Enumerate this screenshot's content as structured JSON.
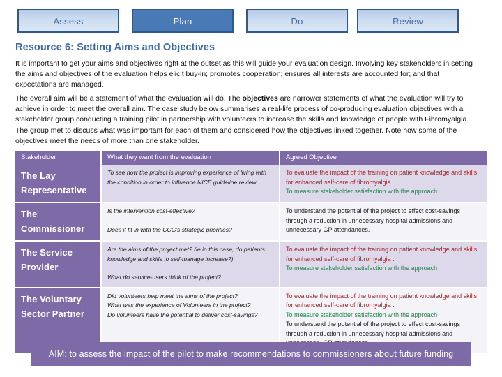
{
  "tabs": [
    {
      "label": "Assess",
      "state": "inactive"
    },
    {
      "label": "Plan",
      "state": "active"
    },
    {
      "label": "Do",
      "state": "inactive"
    },
    {
      "label": "Review",
      "state": "inactive"
    }
  ],
  "resource": {
    "title": "Resource 6: Setting Aims and Objectives",
    "paragraph_1": "It is important to get your aims and objectives right at the outset as this will guide your evaluation design. Involving key stakeholders in setting the aims and objectives of the evaluation helps elicit buy-in; promotes cooperation; ensures all interests are accounted for; and that expectations are managed.",
    "paragraph_2_part_1": "The overall aim will be a statement of what the evaluation will do. The ",
    "paragraph_2_bold": "objectives",
    "paragraph_2_part_2": " are narrower statements of what the evaluation will try to achieve in order to meet the overall aim.  The case study below summarises a real-life process of co-producing evaluation objectives with a stakeholder group conducting a training pilot in partnership with volunteers to increase the skills and knowledge of people with Fibromyalgia.  The group met to discuss what was important for each of them and considered how the objectives linked together. Note how some of the objectives meet the needs of more than one stakeholder."
  },
  "table": {
    "headers": [
      "Stakeholder",
      "What they want from the evaluation",
      "Agreed Objective"
    ],
    "rows": [
      {
        "stakeholder": "The Lay Representative",
        "want": [
          "To see how the project is improving experience of living with the condition in order to influence NICE guideline review"
        ],
        "objectives": [
          {
            "text": "To evaluate the  impact of the training on patient knowledge and skills for enhanced self-care of fibromyalgia",
            "color_name": "red"
          },
          {
            "text": "To measure stakeholder satisfaction with the approach",
            "color_name": "green"
          }
        ]
      },
      {
        "stakeholder": "The Commissioner",
        "want": [
          "Is the intervention cost-effective?",
          "",
          "Does it fit in with the CCG's strategic priorities?"
        ],
        "objectives": [
          {
            "text": "To understand the potential of the project to effect cost-savings through a reduction in unnecessary hospital admissions and unnecessary GP attendances.",
            "color_name": "dark"
          }
        ]
      },
      {
        "stakeholder": "The Service Provider",
        "want": [
          "Are the aims of the project met? (ie in this case, do patients' knowledge and skills to self-manage increase?)",
          "",
          "What do service-users think of the project?"
        ],
        "objectives": [
          {
            "text": "To evaluate the  impact of the training on patient knowledge and skills for enhanced self-care of fibromyalgia .",
            "color_name": "red"
          },
          {
            "text": "To measure stakeholder satisfaction with the approach",
            "color_name": "green"
          }
        ]
      },
      {
        "stakeholder": "The Voluntary Sector Partner",
        "want": [
          "Did volunteers help meet the aims of the project?",
          "What was the experience of Volunteers in the project?",
          "Do volunteers have the potential to deliver cost-savings?"
        ],
        "objectives": [
          {
            "text": "To evaluate the  impact of the training on patient knowledge and skills for enhanced self-care of fibromyalgia .",
            "color_name": "red"
          },
          {
            "text": "To measure stakeholder satisfaction with the approach",
            "color_name": "green"
          },
          {
            "text": "To understand the potential of the project to effect cost-savings through a reduction in unnecessary hospital admissions and unnecessary GP attendances.",
            "color_name": "dark"
          }
        ]
      }
    ]
  },
  "aim_banner": {
    "text": "AIM: to assess the impact of the pilot to make recommendations to commissioners about future funding"
  },
  "colors": {
    "purple": "#7d6aa6",
    "tab_active_blue": "#4a7ab5",
    "tab_border_blue": "#2e5a8e",
    "tab_text_blue": "#3f6ba5",
    "heading_blue": "#3f6ba5",
    "objective_red": "#9e2a2b",
    "objective_green": "#1f8a4c",
    "objective_dark": "#1a1a1a",
    "row_shade": "#ded9ea",
    "row_plain": "#f4f3f8"
  }
}
